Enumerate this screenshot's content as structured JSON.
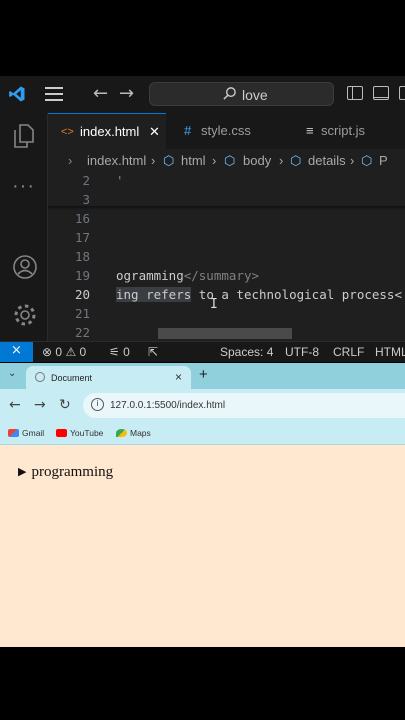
{
  "vscode": {
    "search_text": "love",
    "tabs": [
      {
        "icon": "<>",
        "label": "index.html",
        "close": "✕"
      },
      {
        "icon": "#",
        "label": "style.css"
      },
      {
        "icon": "≡",
        "label": "script.js"
      }
    ],
    "breadcrumb": [
      "index.html",
      "html",
      "body",
      "details",
      "P"
    ],
    "lines": [
      {
        "num": "2",
        "code": "'"
      },
      {
        "num": "3",
        "code": ""
      },
      {
        "num": "16",
        "code": ""
      },
      {
        "num": "17",
        "code": ""
      },
      {
        "num": "18",
        "code": ""
      },
      {
        "num": "19",
        "code_text": "ogramming",
        "code_tag": "</summary>"
      },
      {
        "num": "20",
        "code_sel": "ing refers",
        "code_rest": " to a technological process<"
      },
      {
        "num": "21",
        "code": ""
      },
      {
        "num": "22",
        "code": ""
      }
    ],
    "status": {
      "remote": "⨯",
      "errors": "0",
      "warnings": "0",
      "ports": "0",
      "spaces": "Spaces: 4",
      "encoding": "UTF-8",
      "eol": "CRLF",
      "language": "HTML"
    }
  },
  "chrome": {
    "tab_title": "Document",
    "tab_close": "×",
    "new_tab": "+",
    "url": "127.0.0.1:5500/index.html",
    "bookmarks": [
      "Gmail",
      "YouTube",
      "Maps"
    ],
    "page": {
      "summary": "programming"
    }
  }
}
